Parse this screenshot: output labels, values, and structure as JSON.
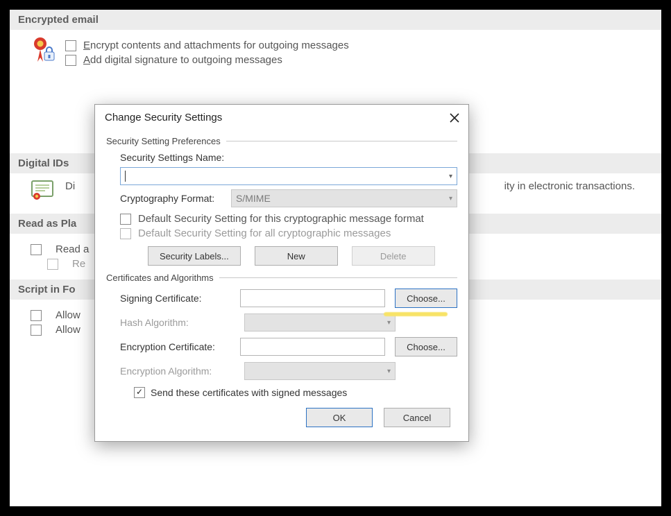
{
  "sections": {
    "encrypted_email": {
      "title": "Encrypted email",
      "encrypt_checkbox": "Encrypt contents and attachments for outgoing messages",
      "encrypt_checkbox_accel": "E",
      "sign_checkbox": "Add digital signature to outgoing messages",
      "sign_checkbox_accel": "A"
    },
    "digital_ids": {
      "title": "Digital IDs",
      "fragment_left": "Di",
      "fragment_right": "ity in electronic transactions."
    },
    "read_as_plain": {
      "title": "Read as Pla",
      "row1": "Read a",
      "row2": "Re"
    },
    "script_folders": {
      "title": "Script in Fo",
      "row1": "Allow",
      "row2": "Allow"
    }
  },
  "dialog": {
    "title": "Change Security Settings",
    "group_prefs": "Security Setting Preferences",
    "name_label": "Security Settings Name:",
    "name_value": "",
    "crypto_label": "Cryptography Format:",
    "crypto_value": "S/MIME",
    "default_this": "Default Security Setting for this cryptographic message format",
    "default_all": "Default Security Setting for all cryptographic messages",
    "btn_labels": "Security Labels...",
    "btn_new": "New",
    "btn_delete": "Delete",
    "group_certs": "Certificates and Algorithms",
    "signing_cert": "Signing Certificate:",
    "hash_algo": "Hash Algorithm:",
    "enc_cert": "Encryption Certificate:",
    "enc_algo": "Encryption Algorithm:",
    "choose": "Choose...",
    "send_certs": "Send these certificates with signed messages",
    "ok": "OK",
    "cancel": "Cancel"
  }
}
